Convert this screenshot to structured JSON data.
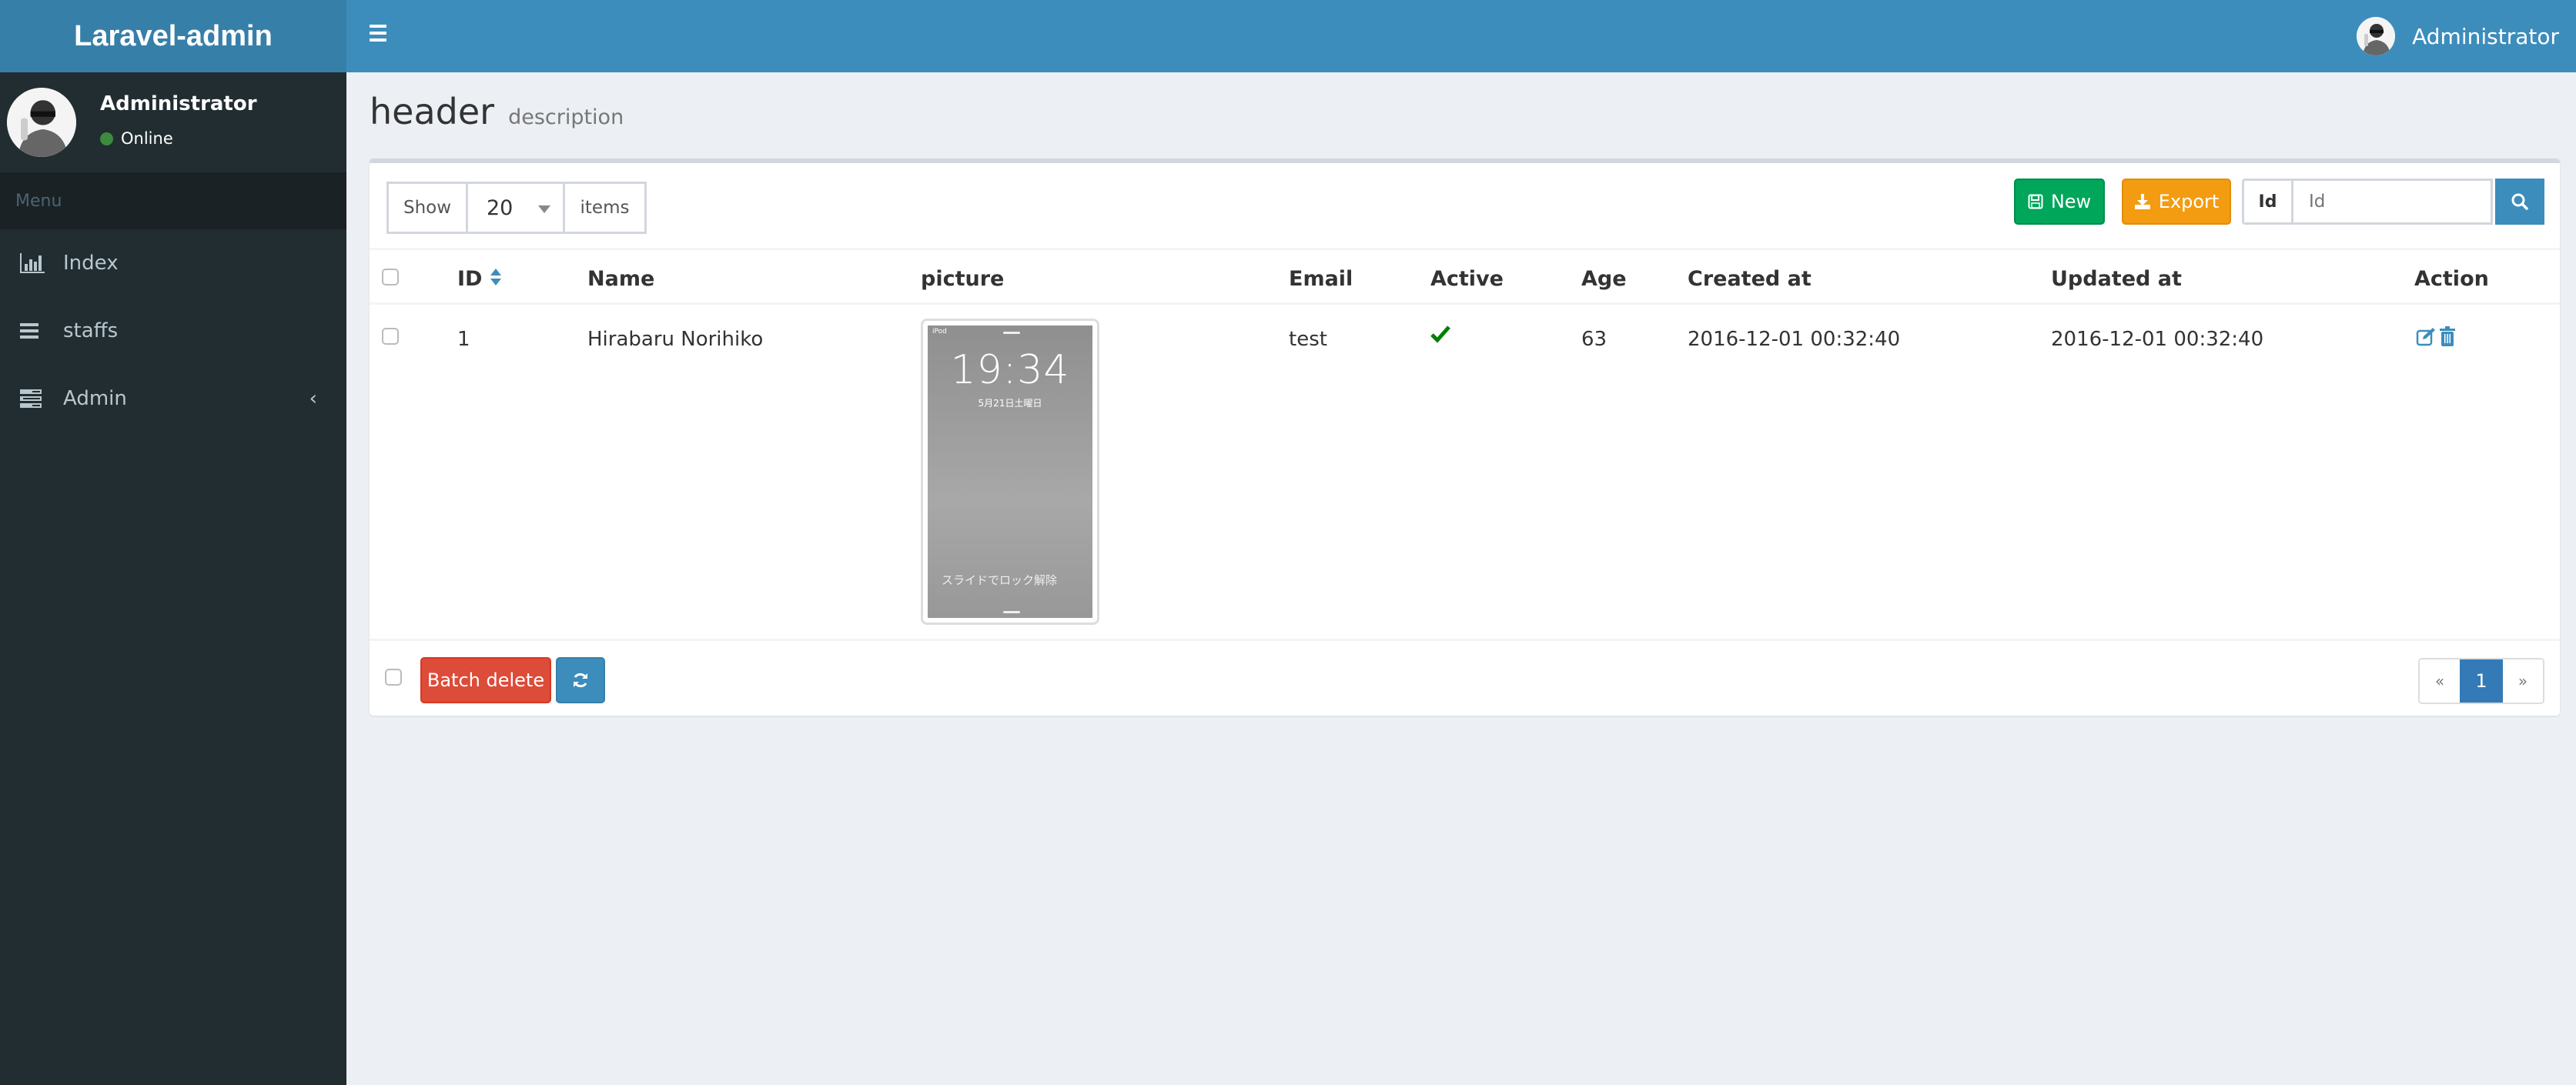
{
  "app": {
    "logo": "Laravel-admin"
  },
  "navbar": {
    "user_name": "Administrator"
  },
  "sidebar": {
    "user_name": "Administrator",
    "status": "Online",
    "status_color": "#3d8b3d",
    "menu_header": "Menu",
    "items": [
      {
        "label": "Index",
        "icon": "bar-chart-icon"
      },
      {
        "label": "staffs",
        "icon": "bars-icon"
      },
      {
        "label": "Admin",
        "icon": "tasks-icon",
        "has_children": true
      }
    ]
  },
  "content": {
    "title": "header",
    "description": "description"
  },
  "toolbar": {
    "show_label": "Show",
    "per_page": "20",
    "items_label": "items",
    "new_label": "New",
    "export_label": "Export",
    "filter_label": "Id",
    "filter_placeholder": "Id",
    "filter_value": ""
  },
  "table": {
    "columns": [
      "ID",
      "Name",
      "picture",
      "Email",
      "Active",
      "Age",
      "Created at",
      "Updated at",
      "Action"
    ],
    "rows": [
      {
        "id": "1",
        "name": "Hirabaru Norihiko",
        "picture": {
          "device": "iPod",
          "time": "19:34",
          "date": "5月21日土曜日",
          "slide_text": "スライドでロック解除"
        },
        "email": "test",
        "active": true,
        "age": "63",
        "created_at": "2016-12-01 00:32:40",
        "updated_at": "2016-12-01 00:32:40"
      }
    ]
  },
  "footer": {
    "batch_delete_label": "Batch delete",
    "pagination": {
      "prev": "«",
      "current": "1",
      "next": "»"
    }
  },
  "colors": {
    "primary": "#3c8dbc",
    "success": "#00a65a",
    "warning": "#f39c12",
    "danger": "#dd4b39",
    "sidebar": "#222d32"
  }
}
